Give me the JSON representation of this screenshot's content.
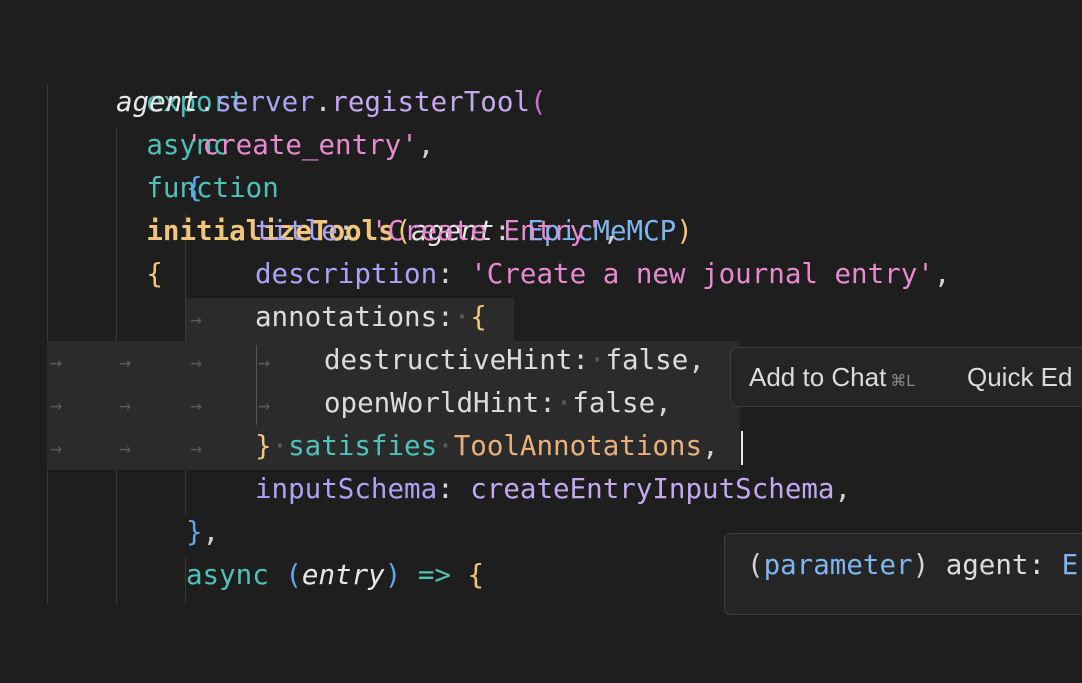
{
  "code": {
    "l1": {
      "export": "export",
      "async": "async",
      "function": "function",
      "fn": "initializeTools",
      "open_paren": "(",
      "param": "agent",
      "colon": ": ",
      "type": "EpicMeMCP",
      "close_paren": ")",
      "brace": "{"
    },
    "l2": {
      "obj": "agent",
      "dot1": ".",
      "member": "server",
      "dot2": ".",
      "method": "registerTool",
      "paren": "("
    },
    "l3": {
      "string": "'create_entry'",
      "comma": ","
    },
    "l4": {
      "brace": "{"
    },
    "l5": {
      "key": "title",
      "colon": ": ",
      "value": "'Create Entry'",
      "comma": ","
    },
    "l6": {
      "key": "description",
      "colon": ": ",
      "value": "'Create a new journal entry'",
      "comma": ","
    },
    "l7": {
      "key": "annotations",
      "colon": ":",
      "brace": "{"
    },
    "l8": {
      "key": "destructiveHint",
      "colon": ":",
      "value": "false",
      "comma": ","
    },
    "l9": {
      "key": "openWorldHint",
      "colon": ":",
      "value": "false",
      "comma": ","
    },
    "l10": {
      "brace": "}",
      "keyword": "satisfies",
      "type": "ToolAnnotations",
      "comma": ","
    },
    "l11": {
      "key": "inputSchema",
      "colon": ": ",
      "value": "createEntryInputSchema",
      "comma": ","
    },
    "l12": {
      "brace": "}",
      "comma": ","
    },
    "l13": {
      "async": "async",
      "open": "(",
      "param": "entry",
      "close": ")",
      "arrow": "=>",
      "brace": "{"
    },
    "whitespace_tab": "→",
    "whitespace_dot": "·",
    "whitespace_guide": "|"
  },
  "inline_menu": {
    "add_to_chat": "Add to Chat",
    "add_to_chat_shortcut": "⌘L",
    "quick_edit": "Quick Ed"
  },
  "hover_info": {
    "open": "(",
    "kind": "parameter",
    "close": ")",
    "name": " agent: ",
    "type_start": "E"
  }
}
